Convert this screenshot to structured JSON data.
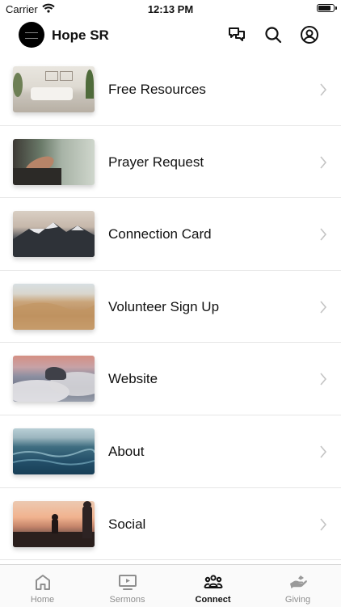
{
  "status_bar": {
    "carrier": "Carrier",
    "time": "12:13 PM",
    "battery_level": 0.9
  },
  "header": {
    "title": "Hope SR",
    "icons": [
      "chat-icon",
      "search-icon",
      "profile-icon"
    ]
  },
  "list": {
    "items": [
      {
        "label": "Free Resources",
        "image": "living-room-photo"
      },
      {
        "label": "Prayer Request",
        "image": "praying-hands-photo"
      },
      {
        "label": "Connection Card",
        "image": "mountains-photo"
      },
      {
        "label": "Volunteer Sign Up",
        "image": "desert-dunes-photo"
      },
      {
        "label": "Website",
        "image": "clouds-photo"
      },
      {
        "label": "About",
        "image": "ocean-waves-photo"
      },
      {
        "label": "Social",
        "image": "sunset-hikers-photo"
      }
    ]
  },
  "tabs": [
    {
      "label": "Home",
      "icon": "home-icon",
      "active": false
    },
    {
      "label": "Sermons",
      "icon": "play-screen-icon",
      "active": false
    },
    {
      "label": "Connect",
      "icon": "people-icon",
      "active": true
    },
    {
      "label": "Giving",
      "icon": "giving-hand-icon",
      "active": false
    }
  ],
  "colors": {
    "active_tab": "#111111",
    "inactive_tab": "#8e8e8e",
    "divider": "#e6e6e6"
  }
}
